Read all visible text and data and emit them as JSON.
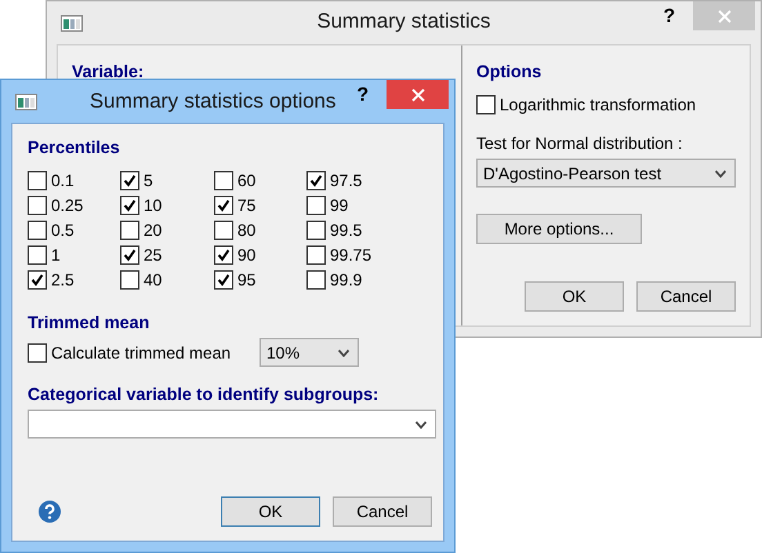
{
  "background_window": {
    "title": "Summary statistics",
    "help_button": "?",
    "active": false,
    "variable_label": "Variable:",
    "options_heading": "Options",
    "log_transform": {
      "label": "Logarithmic transformation",
      "checked": false
    },
    "normality_test": {
      "label": "Test for Normal distribution :",
      "value": "D'Agostino-Pearson test"
    },
    "more_options_button": "More options...",
    "buttons": [
      "OK",
      "Cancel"
    ]
  },
  "dialog": {
    "title": "Summary statistics options",
    "help_button": "?",
    "active": true,
    "percentiles_heading": "Percentiles",
    "percentiles": [
      {
        "label": "0.1",
        "checked": false
      },
      {
        "label": "5",
        "checked": true
      },
      {
        "label": "60",
        "checked": false
      },
      {
        "label": "97.5",
        "checked": true
      },
      {
        "label": "0.25",
        "checked": false
      },
      {
        "label": "10",
        "checked": true
      },
      {
        "label": "75",
        "checked": true
      },
      {
        "label": "99",
        "checked": false
      },
      {
        "label": "0.5",
        "checked": false
      },
      {
        "label": "20",
        "checked": false
      },
      {
        "label": "80",
        "checked": false
      },
      {
        "label": "99.5",
        "checked": false
      },
      {
        "label": "1",
        "checked": false
      },
      {
        "label": "25",
        "checked": true
      },
      {
        "label": "90",
        "checked": true
      },
      {
        "label": "99.75",
        "checked": false
      },
      {
        "label": "2.5",
        "checked": true
      },
      {
        "label": "40",
        "checked": false
      },
      {
        "label": "95",
        "checked": true
      },
      {
        "label": "99.9",
        "checked": false
      }
    ],
    "trimmed_heading": "Trimmed mean",
    "trimmed_checkbox": {
      "label": "Calculate trimmed mean",
      "checked": false
    },
    "trim_percent": "10%",
    "subgroup_label": "Categorical variable to identify subgroups:",
    "buttons": [
      "OK",
      "Cancel"
    ]
  }
}
